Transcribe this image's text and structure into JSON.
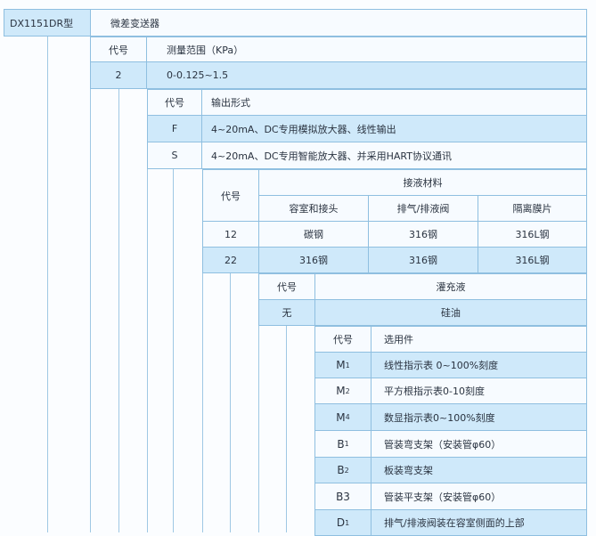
{
  "model": {
    "code": "DX1151DR型",
    "name": "微差变送器"
  },
  "range": {
    "code_header": "代号",
    "value_header": "测量范围（KPa）",
    "code": "2",
    "value": "0-0.125~1.5"
  },
  "output": {
    "code_header": "代号",
    "value_header": "输出形式",
    "rows": [
      {
        "code": "F",
        "value": "4~20mA、DC专用模拟放大器、线性输出"
      },
      {
        "code": "S",
        "value": "4~20mA、DC专用智能放大器、并采用HART协议通讯"
      }
    ]
  },
  "material": {
    "code_header": "代号",
    "title": "接液材料",
    "columns": [
      "容室和接头",
      "排气/排液阀",
      "隔离膜片"
    ],
    "rows": [
      {
        "code": "12",
        "values": [
          "碳钢",
          "316钢",
          "316L钢"
        ]
      },
      {
        "code": "22",
        "values": [
          "316钢",
          "316钢",
          "316L钢"
        ]
      }
    ]
  },
  "fill": {
    "code_header": "代号",
    "value_header": "灌充液",
    "code": "无",
    "value": "硅油"
  },
  "options": {
    "code_header": "代号",
    "value_header": "选用件",
    "rows": [
      {
        "code": "M",
        "sub": "1",
        "value": "线性指示表 0~100%刻度"
      },
      {
        "code": "M",
        "sub": "2",
        "value": "平方根指示表0-10刻度"
      },
      {
        "code": "M",
        "sub": "4",
        "value": "数显指示表0~100%刻度"
      },
      {
        "code": "B",
        "sub": "1",
        "value": "管装弯支架（安装管φ60）"
      },
      {
        "code": "B",
        "sub": "2",
        "value": "板装弯支架"
      },
      {
        "code": "B3",
        "sub": "",
        "value": "管装平支架（安装管φ60）"
      },
      {
        "code": "D",
        "sub": "1",
        "value": "排气/排液阀装在容室侧面的上部"
      }
    ]
  }
}
